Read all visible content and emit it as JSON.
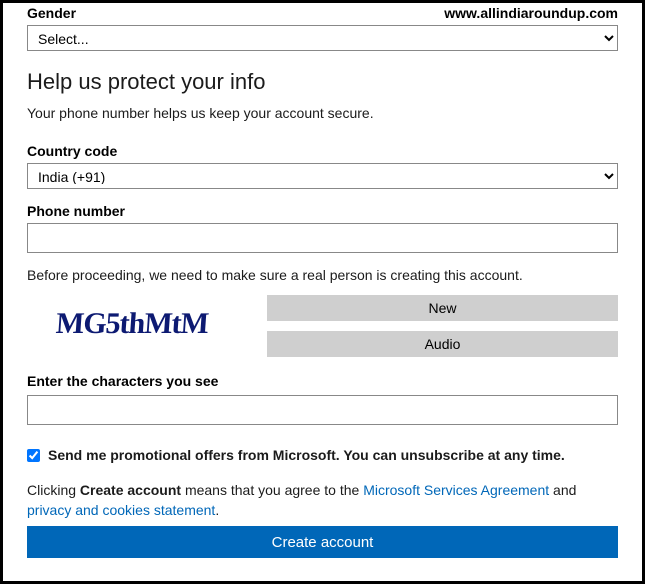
{
  "watermark": "www.allindiaroundup.com",
  "gender": {
    "label": "Gender",
    "selected": "Select..."
  },
  "section_heading": "Help us protect your info",
  "section_sub": "Your phone number helps us keep your account secure.",
  "country": {
    "label": "Country code",
    "selected": "India (+91)"
  },
  "phone": {
    "label": "Phone number",
    "value": ""
  },
  "captcha": {
    "before_text": "Before proceeding, we need to make sure a real person is creating this account.",
    "image_text": "MG5thMtM",
    "new_label": "New",
    "audio_label": "Audio",
    "enter_label": "Enter the characters you see",
    "value": ""
  },
  "promo": {
    "checked": true,
    "label": "Send me promotional offers from Microsoft. You can unsubscribe at any time."
  },
  "legal": {
    "prefix": "Clicking ",
    "bold": "Create account",
    "mid": " means that you agree to the ",
    "link1": "Microsoft Services Agreement",
    "sep": " and ",
    "link2": "privacy and cookies statement",
    "suffix": "."
  },
  "submit_label": "Create account"
}
